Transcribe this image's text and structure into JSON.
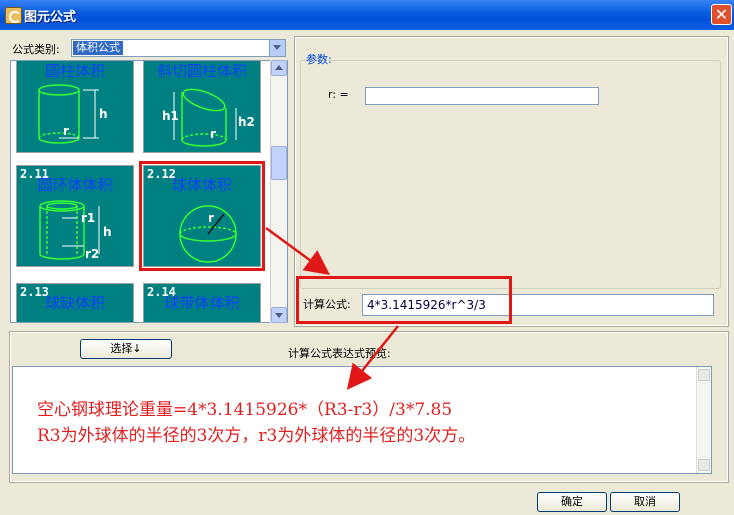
{
  "window": {
    "title": "图元公式",
    "close_glyph": "✕"
  },
  "category": {
    "label": "公式类别:",
    "value": "体积公式"
  },
  "gallery": {
    "cards": [
      {
        "num": "",
        "title": "圆柱体积",
        "figure": "cylinder",
        "labels": [
          "h",
          "r"
        ]
      },
      {
        "num": "",
        "title": "斜切圆柱体积",
        "figure": "oblique-cylinder",
        "labels": [
          "h1",
          "h2",
          "r"
        ]
      },
      {
        "num": "2.11",
        "title": "圆环体体积",
        "figure": "hollow-cylinder",
        "labels": [
          "r1",
          "h",
          "r2"
        ]
      },
      {
        "num": "2.12",
        "title": "球体体积",
        "figure": "sphere",
        "labels": [
          "r"
        ],
        "selected": true
      },
      {
        "num": "2.13",
        "title": "球缺体积",
        "figure": "spherical-cap",
        "labels": []
      },
      {
        "num": "2.14",
        "title": "球带体体积",
        "figure": "spherical-zone",
        "labels": []
      }
    ]
  },
  "params": {
    "label": "参数:",
    "r_label": "r: =",
    "r_value": ""
  },
  "calc": {
    "label": "计算公式:",
    "formula": "4*3.1415926*r^3/3"
  },
  "select_button": "选择↓",
  "preview": {
    "label": "计算公式表达式预览:",
    "lines": [
      "空心钢球理论重量=4*3.1415926*（R3-r3）/3*7.85",
      "R3为外球体的半径的3次方，r3为外球体的半径的3次方。"
    ]
  },
  "buttons": {
    "ok": "确定",
    "cancel": "取消"
  },
  "colors": {
    "card_bg": "#008080",
    "figure_line": "#33ff33",
    "title_text": "#1040ff",
    "annotation": "#e01818"
  }
}
